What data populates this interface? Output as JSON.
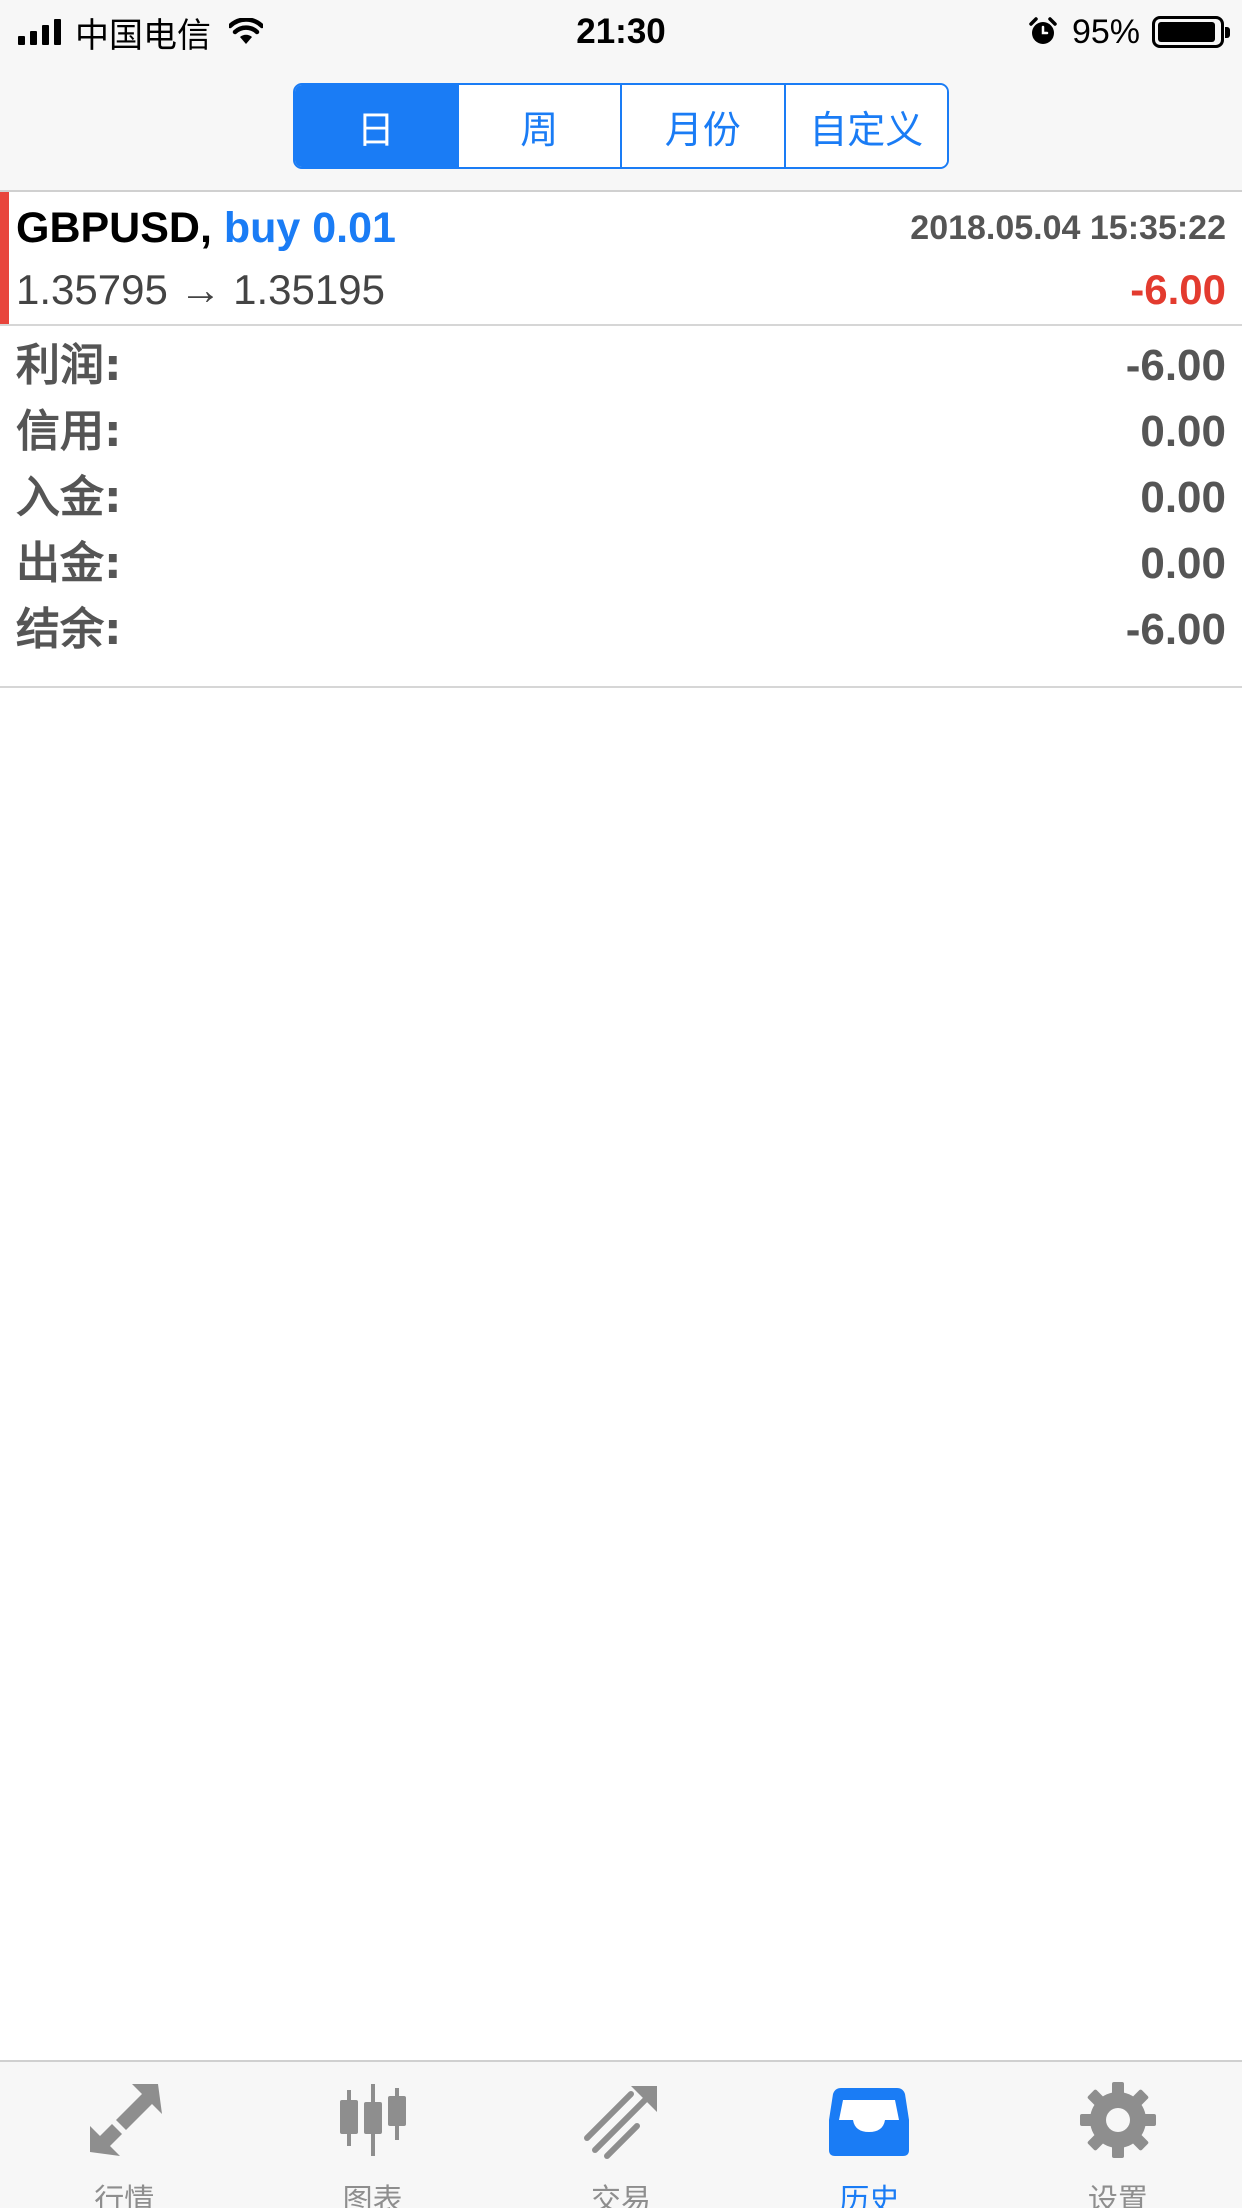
{
  "status_bar": {
    "carrier": "中国电信",
    "time": "21:30",
    "battery": "95%"
  },
  "segments": [
    {
      "label": "日",
      "active": true
    },
    {
      "label": "周",
      "active": false
    },
    {
      "label": "月份",
      "active": false
    },
    {
      "label": "自定义",
      "active": false
    }
  ],
  "trade": {
    "symbol": "GBPUSD,",
    "side": "buy 0.01",
    "datetime": "2018.05.04 15:35:22",
    "prices": "1.35795 → 1.35195",
    "profit": "-6.00",
    "marker_color": "#e8453c"
  },
  "summary": {
    "profit": {
      "label": "利润:",
      "value": "-6.00"
    },
    "credit": {
      "label": "信用:",
      "value": "0.00"
    },
    "deposit": {
      "label": "入金:",
      "value": "0.00"
    },
    "withdrawal": {
      "label": "出金:",
      "value": "0.00"
    },
    "balance": {
      "label": "结余:",
      "value": "-6.00"
    }
  },
  "tabbar": [
    {
      "label": "行情",
      "icon": "quotes-arrows-icon",
      "active": false
    },
    {
      "label": "图表",
      "icon": "candlestick-chart-icon",
      "active": false
    },
    {
      "label": "交易",
      "icon": "trade-lines-icon",
      "active": false
    },
    {
      "label": "历史",
      "icon": "history-inbox-icon",
      "active": true
    },
    {
      "label": "设置",
      "icon": "gear-icon",
      "active": false
    }
  ],
  "colors": {
    "accent": "#1a7cf5",
    "loss": "#e33b2f",
    "inactive_icon": "#8e8e8e"
  }
}
